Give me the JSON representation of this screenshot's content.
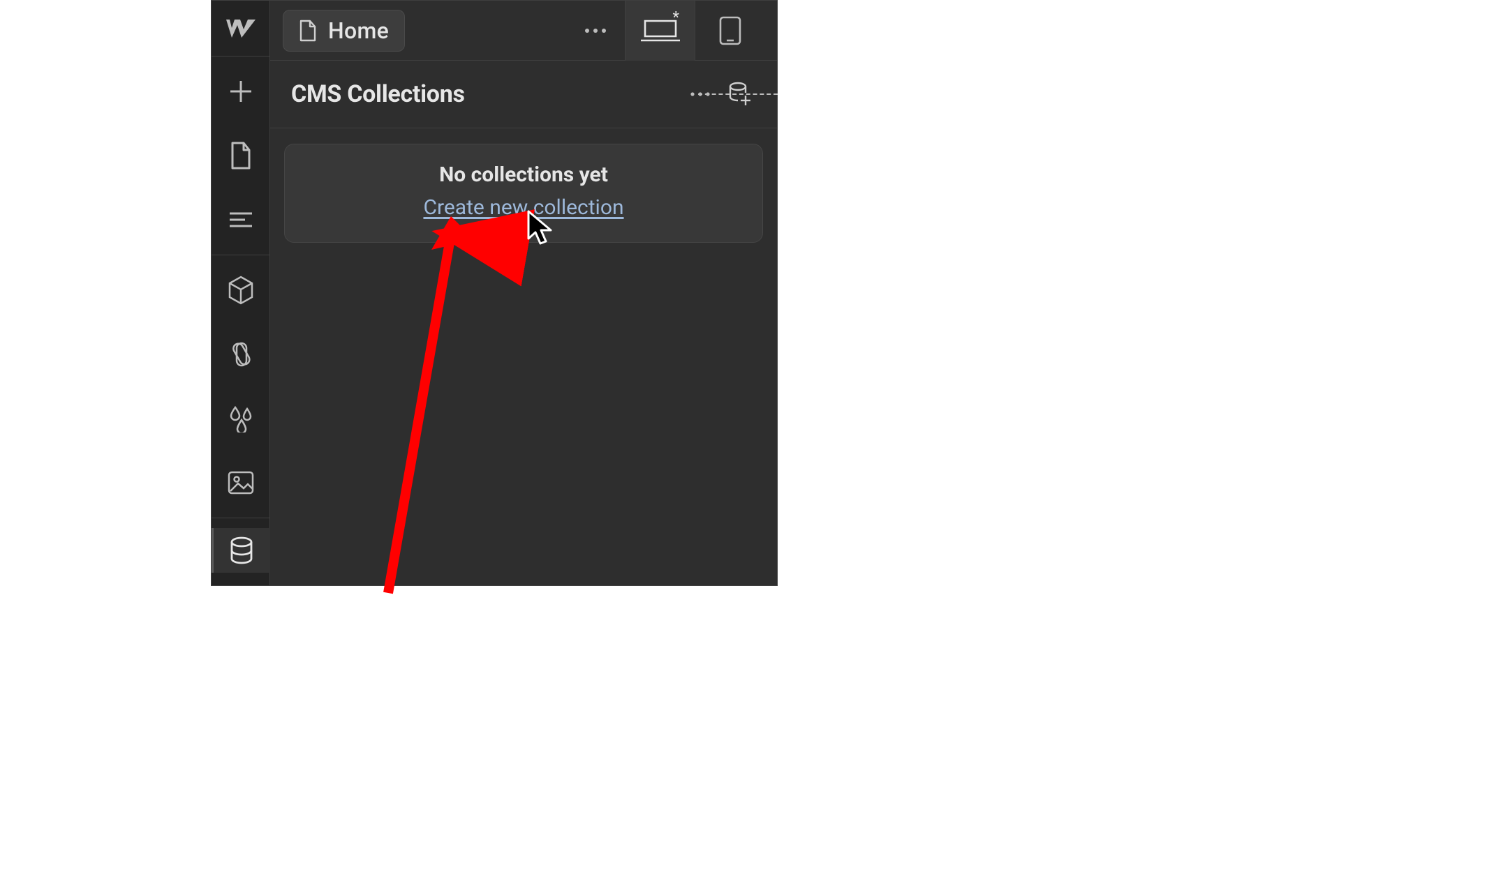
{
  "topbar": {
    "page_label": "Home",
    "more_label": "…",
    "breakpoints": {
      "desktop_modified": "*"
    }
  },
  "sidebar": {
    "logo": "webflow-logo",
    "tools": [
      {
        "name": "add",
        "active": false
      },
      {
        "name": "pages",
        "active": false
      },
      {
        "name": "navigator",
        "active": false
      }
    ],
    "design": [
      {
        "name": "components",
        "active": false
      },
      {
        "name": "variables",
        "active": false
      },
      {
        "name": "styles",
        "active": false
      },
      {
        "name": "assets",
        "active": false
      }
    ],
    "data": [
      {
        "name": "cms",
        "active": true
      }
    ]
  },
  "panel": {
    "title": "CMS Collections",
    "empty": {
      "title": "No collections yet",
      "cta": "Create new collection"
    }
  },
  "annotation": {
    "arrow_color": "#FF0000"
  }
}
